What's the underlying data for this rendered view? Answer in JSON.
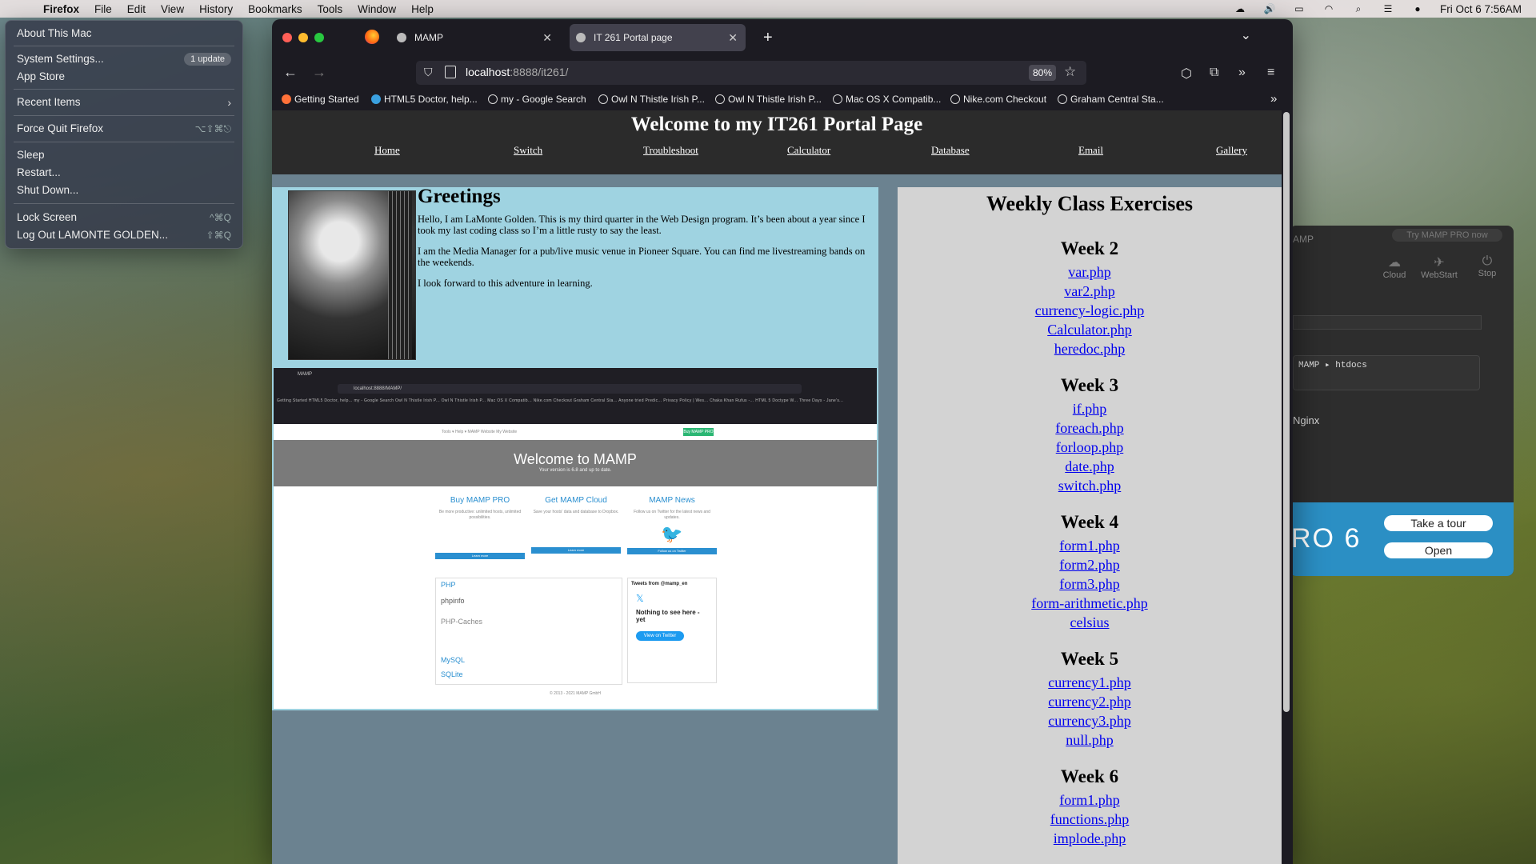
{
  "menubar": {
    "items": [
      "Firefox",
      "File",
      "Edit",
      "View",
      "History",
      "Bookmarks",
      "Tools",
      "Window",
      "Help"
    ],
    "datetime": "Fri Oct 6  7:56AM"
  },
  "apple_menu": {
    "about": "About This Mac",
    "settings": "System Settings...",
    "settings_badge": "1 update",
    "app_store": "App Store",
    "recent": "Recent Items",
    "force_quit": "Force Quit Firefox",
    "force_quit_sc": "⌥⇧⌘⎋",
    "sleep": "Sleep",
    "restart": "Restart...",
    "shutdown": "Shut Down...",
    "lock": "Lock Screen",
    "lock_sc": "^⌘Q",
    "logout": "Log Out LAMONTE GOLDEN...",
    "logout_sc": "⇧⌘Q"
  },
  "mamp_app": {
    "title": "AMP",
    "try_pro": "Try MAMP PRO now",
    "tools": [
      "Cloud",
      "WebStart",
      "Stop"
    ],
    "path": "MAMP ▸ htdocs",
    "server": "Nginx",
    "banner_text": "RO 6",
    "tour_button": "Take a tour",
    "open_button": "Open"
  },
  "browser": {
    "tabs": [
      {
        "label": "MAMP"
      },
      {
        "label": "IT 261 Portal page"
      }
    ],
    "url_host": "localhost",
    "url_path": ":8888/it261/",
    "zoom": "80%",
    "bookmarks": [
      "Getting Started",
      "HTML5 Doctor, help...",
      "my - Google Search",
      "Owl N Thistle Irish P...",
      "Owl N Thistle Irish P...",
      "Mac OS X Compatib...",
      "Nike.com Checkout",
      "Graham Central Sta..."
    ]
  },
  "page": {
    "title": "Welcome to my IT261 Portal Page",
    "nav": [
      "Home",
      "Switch",
      "Troubleshoot",
      "Calculator",
      "Database",
      "Email",
      "Gallery"
    ],
    "greeting_title": "Greetings",
    "paragraphs": [
      "Hello, I am LaMonte Golden. This is my third quarter in the Web Design program. It’s been about a year since I took my last coding class so I’m a little rusty to say the least.",
      "I am the Media Manager for a pub/live music venue in Pioneer Square. You can find me livestreaming bands on the weekends.",
      "I look forward to this adventure in learning."
    ],
    "exercises_title": "Weekly Class Exercises",
    "weeks": [
      {
        "title": "Week 2",
        "links": [
          "var.php",
          "var2.php",
          "currency-logic.php",
          "Calculator.php",
          "heredoc.php"
        ]
      },
      {
        "title": "Week 3",
        "links": [
          "if.php",
          "foreach.php",
          "forloop.php",
          "date.php",
          "switch.php"
        ]
      },
      {
        "title": "Week 4",
        "links": [
          "form1.php",
          "form2.php",
          "form3.php",
          "form-arithmetic.php",
          "celsius"
        ]
      },
      {
        "title": "Week 5",
        "links": [
          "currency1.php",
          "currency2.php",
          "currency3.php",
          "null.php"
        ]
      },
      {
        "title": "Week 6",
        "links": [
          "form1.php",
          "functions.php",
          "implode.php"
        ]
      }
    ]
  },
  "embedded_screenshot": {
    "tab": "MAMP",
    "url": "localhost:8888/MAMP/",
    "bookmarks": "Getting Started  HTML5 Doctor, help...  my - Google Search  Owl N Thistle Irish P...  Owl N Thistle Irish P...  Mac OS X Compatib...  Nike.com Checkout  Graham Central Sta...  Anyone tried Predic...  Privacy Policy | Wes...  Chaka Khan Rufus -...  HTML 5 Doctype W...  Three Days - Jane's...",
    "toplinks": "Tools ▾   Help ▾   MAMP Website   My Website",
    "buy_button": "Buy MAMP PRO",
    "hero_title": "Welcome to MAMP",
    "hero_sub": "Your version is 6.8 and up to date.",
    "columns": [
      {
        "title": "Buy MAMP PRO",
        "text": "Be more productive: unlimited hosts, unlimited possibilities.",
        "button": "Learn more"
      },
      {
        "title": "Get MAMP Cloud",
        "text": "Save your hosts' data and database to Dropbox.",
        "button": "Learn more"
      },
      {
        "title": "MAMP News",
        "text": "Follow us on Twitter for the latest news and updates.",
        "button": "Follow us on Twitter"
      }
    ],
    "php_rows": [
      "PHP",
      "phpinfo",
      "PHP-Caches",
      "MySQL",
      "SQLite"
    ],
    "tweets_title": "Tweets from @mamp_en",
    "tweets_empty": "Nothing to see here - yet",
    "tweets_button": "View on Twitter",
    "footer": "© 2013 - 2021 MAMP GmbH"
  }
}
